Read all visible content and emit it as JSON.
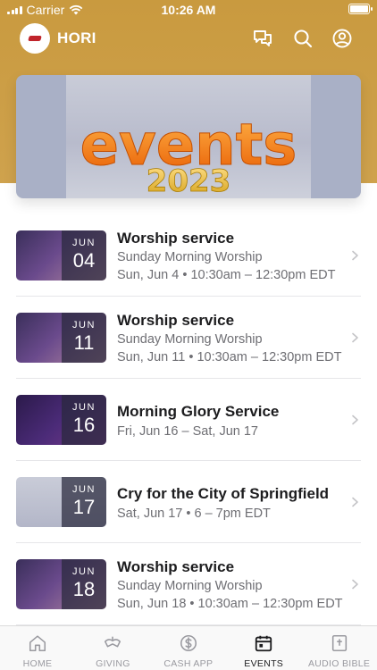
{
  "status_bar": {
    "carrier": "Carrier",
    "time": "10:26 AM"
  },
  "header": {
    "app_name": "HORI",
    "icons": [
      "chat-icon",
      "search-icon",
      "account-icon"
    ]
  },
  "hero": {
    "title_text": "events",
    "year_text": "2023"
  },
  "events": [
    {
      "title": "Worship service",
      "subtitle": "Sunday Morning Worship",
      "when": "Sun, Jun 4 • 10:30am – 12:30pm EDT",
      "month": "JUN",
      "day": "04",
      "thumb": "worship"
    },
    {
      "title": "Worship service",
      "subtitle": "Sunday Morning Worship",
      "when": "Sun, Jun 11 • 10:30am – 12:30pm EDT",
      "month": "JUN",
      "day": "11",
      "thumb": "worship"
    },
    {
      "title": "Morning Glory Service",
      "subtitle": "Fri, Jun 16 – Sat, Jun 17",
      "when": "",
      "month": "JUN",
      "day": "16",
      "thumb": "glory"
    },
    {
      "title": "Cry for the City of Springfield",
      "subtitle": "Sat, Jun 17 • 6 – 7pm EDT",
      "when": "",
      "month": "JUN",
      "day": "17",
      "thumb": "events"
    },
    {
      "title": "Worship service",
      "subtitle": "Sunday Morning Worship",
      "when": "Sun, Jun 18 • 10:30am – 12:30pm EDT",
      "month": "JUN",
      "day": "18",
      "thumb": "worship"
    }
  ],
  "tabs": [
    {
      "label": "HOME",
      "icon": "home-icon",
      "active": false
    },
    {
      "label": "GIVING",
      "icon": "giving-icon",
      "active": false
    },
    {
      "label": "CASH APP",
      "icon": "cash-app-icon",
      "active": false
    },
    {
      "label": "EVENTS",
      "icon": "calendar-icon",
      "active": true
    },
    {
      "label": "AUDIO BIBLE",
      "icon": "bible-icon",
      "active": false
    }
  ],
  "colors": {
    "header_gold": "#c99a3f",
    "text_primary": "#1c1c1e",
    "text_secondary": "#6e6e73",
    "tab_inactive": "#9a9aa0"
  }
}
